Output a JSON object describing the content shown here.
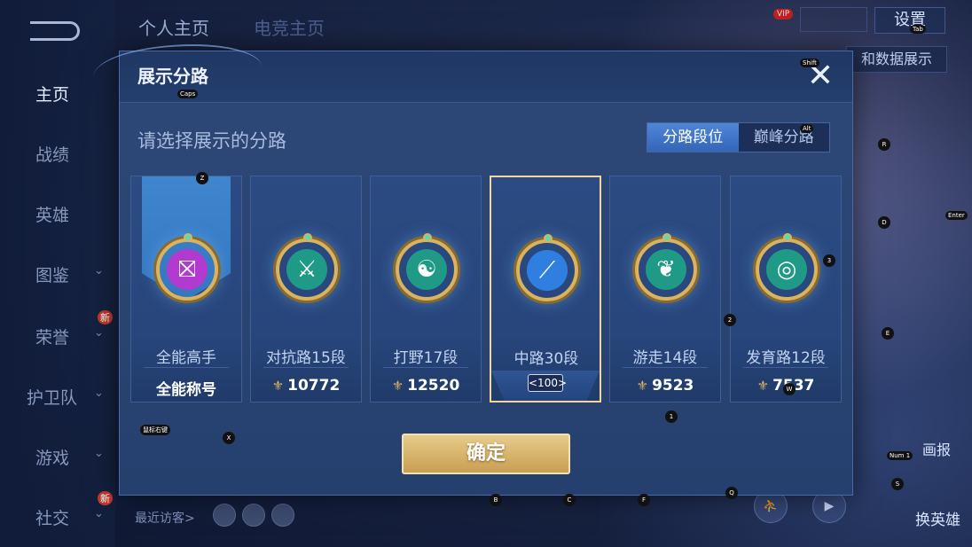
{
  "left_nav": {
    "items": [
      {
        "label": "主页",
        "active": true,
        "chevron": false,
        "badge": ""
      },
      {
        "label": "战绩",
        "active": false,
        "chevron": false,
        "badge": ""
      },
      {
        "label": "英雄",
        "active": false,
        "chevron": false,
        "badge": ""
      },
      {
        "label": "图鉴",
        "active": false,
        "chevron": true,
        "badge": ""
      },
      {
        "label": "荣誉",
        "active": false,
        "chevron": true,
        "badge": "新"
      },
      {
        "label": "护卫队",
        "active": false,
        "chevron": true,
        "badge": ""
      },
      {
        "label": "游戏",
        "active": false,
        "chevron": true,
        "badge": ""
      },
      {
        "label": "社交",
        "active": false,
        "chevron": true,
        "badge": "新"
      }
    ]
  },
  "header": {
    "tabs": [
      "个人主页",
      "电竞主页"
    ],
    "settings_label": "设置",
    "vip_label": "VIP",
    "data_button_label": "和数据展示"
  },
  "footer": {
    "recent_visitors_label": "最近访客>",
    "report_label": "画报",
    "change_hero_label": "换英雄"
  },
  "dialog": {
    "title": "展示分路",
    "close_glyph": "✕",
    "subtitle": "请选择展示的分路",
    "toggle": {
      "left": "分路段位",
      "right": "巅峰分路",
      "selected": "left"
    },
    "cards": [
      {
        "label": "全能高手",
        "score": "全能称号",
        "coin": false,
        "glyph": "⛝",
        "color": "#b23ad0",
        "selected": false,
        "banner": true
      },
      {
        "label": "对抗路15段",
        "score": "10772",
        "coin": true,
        "glyph": "⚔",
        "color": "#1e9a86",
        "selected": false,
        "banner": false
      },
      {
        "label": "打野17段",
        "score": "12520",
        "coin": true,
        "glyph": "☯",
        "color": "#1e9a86",
        "selected": false,
        "banner": false
      },
      {
        "label": "中路30段",
        "score": "",
        "coin": false,
        "glyph": "⟋",
        "color": "#2f7fe0",
        "selected": true,
        "banner": false,
        "rank": "<100>"
      },
      {
        "label": "游走14段",
        "score": "9523",
        "coin": true,
        "glyph": "❦",
        "color": "#1e9a86",
        "selected": false,
        "banner": false
      },
      {
        "label": "发育路12段",
        "score": "7537",
        "coin": true,
        "glyph": "◎",
        "color": "#1e9a86",
        "selected": false,
        "banner": false
      }
    ],
    "confirm_label": "确定"
  },
  "key_hints": {
    "tab": "Tab",
    "shift": "Shift",
    "caps": "Caps",
    "z": "Z",
    "alt": "Alt",
    "r": "R",
    "d": "D",
    "enter": "Enter",
    "three": "3",
    "two": "2",
    "e": "E",
    "one": "1",
    "mouse": "鼠标右键",
    "x": "X",
    "num1": "Num 1",
    "s": "S",
    "b": "B",
    "c": "C",
    "f": "F",
    "q": "Q",
    "w": "W"
  }
}
